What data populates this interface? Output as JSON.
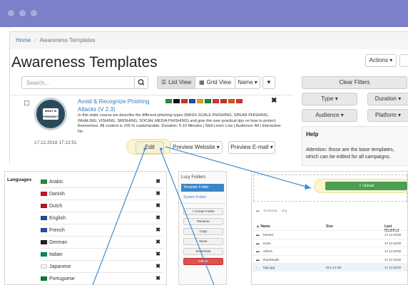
{
  "breadcrumb": {
    "home": "Home",
    "current": "Awareness Templates"
  },
  "page_title": "Awareness Templates",
  "actions_label": "Actions ▾",
  "search": {
    "placeholder": "Search..."
  },
  "view": {
    "list": "List View",
    "grid": "Grid View",
    "sort": "Name ▾",
    "filter_arrow": "▼"
  },
  "filters": {
    "clear": "Clear Filters",
    "type": "Type ▾",
    "duration": "Duration ▾",
    "audience": "Audience ▾",
    "platform": "Platform ▾"
  },
  "help": {
    "title": "Help",
    "text": "Attention: those are the base templates, which can be edited for all campaigns."
  },
  "card": {
    "title": "Avoid & Recognize Phishing Attacks (V 2.3)",
    "description": "In this static course we describe the different phishing types (MASS-SCALE PHISHING, SPEAR PHISHING, WHALING, VISHING, SMISHING, SOCIAL MEDIA PHISHING) and give the user practical tips on how to protect themselves. All content is 100 % customizable. Duration: 5-10 Minutes | Skill Level: Low | Audience: All | Interactive: No",
    "date": "17.12.2018 17:12:51",
    "edit": "Edit",
    "preview_website": "Preview Website ▾",
    "preview_email": "Preview E-mail ▾",
    "thumb_text": "WHAT IS PHISHING?",
    "flag_colors": [
      "#2e8b3d",
      "#111111",
      "#c0392b",
      "#1f4fa0",
      "#d8a520",
      "#0a8a4c",
      "#d33",
      "#c0392b",
      "#cf5a1a",
      "#e03030"
    ]
  },
  "languages": {
    "heading": "Languages",
    "items": [
      {
        "name": "Arabic",
        "color": "#2e8b3d"
      },
      {
        "name": "Danish",
        "color": "#c8102e"
      },
      {
        "name": "Dutch",
        "color": "#ae1c28"
      },
      {
        "name": "English",
        "color": "#1f4fa0"
      },
      {
        "name": "French",
        "color": "#2a4fa3"
      },
      {
        "name": "German",
        "color": "#222222"
      },
      {
        "name": "Italian",
        "color": "#0a8a4c"
      },
      {
        "name": "Japanese",
        "color": "#f3f3f3"
      },
      {
        "name": "Portuguese",
        "color": "#0a7a3a"
      }
    ]
  },
  "folders": {
    "title": "Lucy Folders",
    "active": "Template Folder",
    "other": "System Folder",
    "buttons": [
      "+ Create Folder",
      "Rename",
      "Copy",
      "Move",
      "Download",
      "Delete"
    ]
  },
  "files": {
    "upload": "Upload",
    "path": [
      "bootstrap",
      "img"
    ],
    "headers": {
      "name": "Name",
      "size": "Size",
      "modified": "Last Modified"
    },
    "rows": [
      {
        "name": "banner",
        "size": "",
        "modified": "17.12.2018"
      },
      {
        "name": "icons",
        "size": "",
        "modified": "17.12.2018"
      },
      {
        "name": "others",
        "size": "",
        "modified": "17.12.2018"
      },
      {
        "name": "thumbnails",
        "size": "",
        "modified": "17.12.2018"
      },
      {
        "name": "logo.jpg",
        "size": "614.12 KB",
        "modified": "17.12.2018"
      }
    ]
  }
}
